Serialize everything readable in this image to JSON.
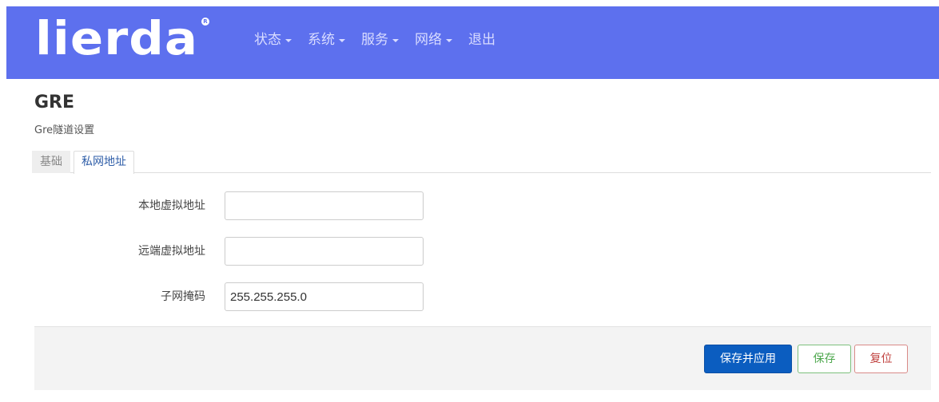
{
  "brand": {
    "logo_text": "lierda",
    "logo_mark": "R"
  },
  "nav": {
    "items": [
      {
        "label": "状态",
        "has_caret": true
      },
      {
        "label": "系统",
        "has_caret": true
      },
      {
        "label": "服务",
        "has_caret": true
      },
      {
        "label": "网络",
        "has_caret": true
      },
      {
        "label": "退出",
        "has_caret": false
      }
    ]
  },
  "page": {
    "title": "GRE",
    "description": "Gre隧道设置"
  },
  "tabs": [
    {
      "label": "基础",
      "active": false
    },
    {
      "label": "私网地址",
      "active": true
    }
  ],
  "form": {
    "fields": [
      {
        "label": "本地虚拟地址",
        "value": ""
      },
      {
        "label": "远端虚拟地址",
        "value": ""
      },
      {
        "label": "子网掩码",
        "value": "255.255.255.0"
      }
    ]
  },
  "actions": {
    "apply_label": "保存并应用",
    "save_label": "保存",
    "reset_label": "复位"
  },
  "colors": {
    "navbar": "#5d70ee",
    "primary_button": "#0b5dc0",
    "save_button": "#4fa84f",
    "reset_button": "#c0413e",
    "active_tab_text": "#2f5ea8"
  }
}
